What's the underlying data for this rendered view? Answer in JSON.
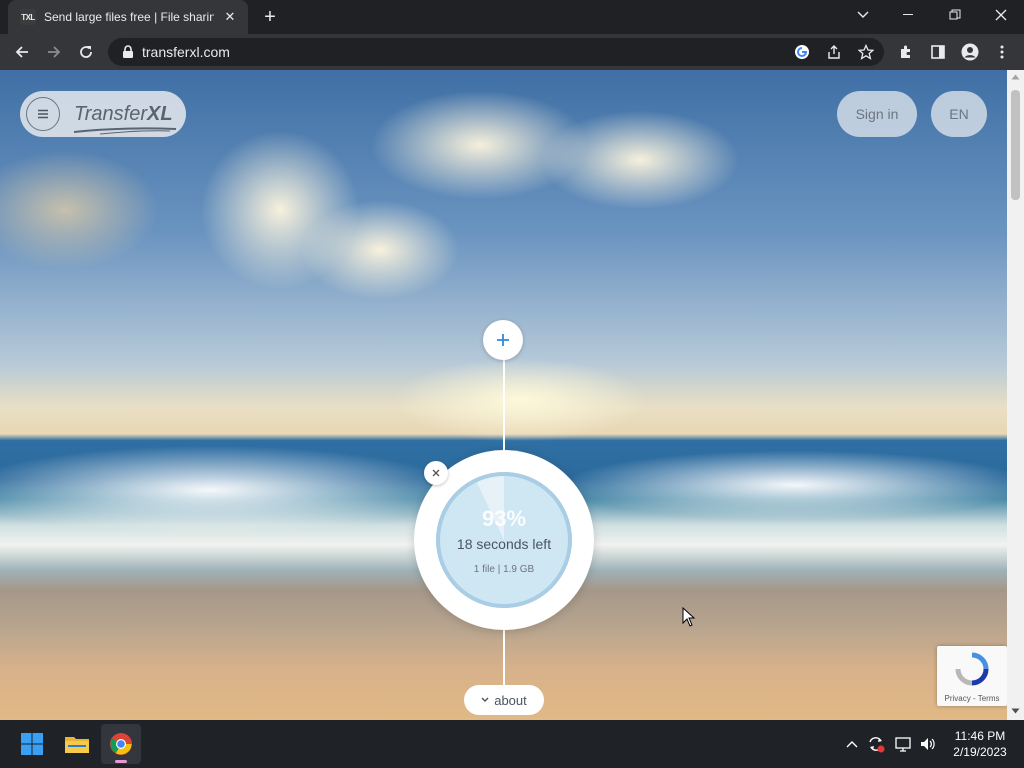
{
  "browser": {
    "tab_favicon": "TXL",
    "tab_title": "Send large files free | File sharing",
    "url": "transferxl.com"
  },
  "page": {
    "logo": {
      "main": "Transfer",
      "accent": "XL"
    },
    "signin_label": "Sign in",
    "language_label": "EN",
    "upload": {
      "percent": "93%",
      "percent_value": 93,
      "time_left": "18 seconds left",
      "file_info": "1 file | 1.9 GB"
    },
    "about_label": "about",
    "recaptcha": {
      "privacy": "Privacy",
      "separator": " - ",
      "terms": "Terms"
    }
  },
  "taskbar": {
    "time": "11:46 PM",
    "date": "2/19/2023"
  },
  "colors": {
    "accent_blue": "#2e8bd8",
    "progress_fill": "#cfe6f3",
    "progress_ring": "#a9cde4"
  }
}
